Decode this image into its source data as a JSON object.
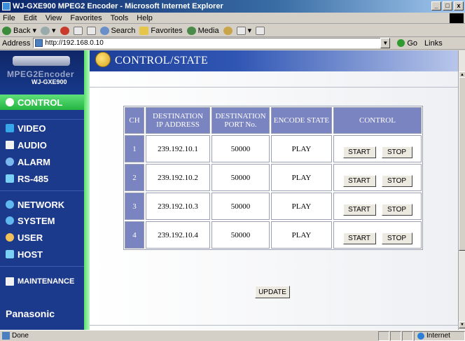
{
  "window": {
    "title": "WJ-GXE900 MPEG2 Encoder - Microsoft Internet Explorer",
    "min": "_",
    "max": "□",
    "close": "x"
  },
  "menu": [
    "File",
    "Edit",
    "View",
    "Favorites",
    "Tools",
    "Help"
  ],
  "toolbar": {
    "back": "Back",
    "search": "Search",
    "favorites": "Favorites",
    "media": "Media"
  },
  "address": {
    "label": "Address",
    "url": "http://192.168.0.10",
    "go": "Go",
    "links": "Links"
  },
  "sidebar": {
    "model_line1": "MPEG2Encoder",
    "model_line2": "WJ-GXE900",
    "items": {
      "control": "CONTROL",
      "video": "VIDEO",
      "audio": "AUDIO",
      "alarm": "ALARM",
      "rs485": "RS-485",
      "network": "NETWORK",
      "system": "SYSTEM",
      "user": "USER",
      "host": "HOST",
      "maintenance": "MAINTENANCE"
    },
    "brand": "Panasonic"
  },
  "page": {
    "title": "CONTROL/STATE",
    "update": "UPDATE"
  },
  "table": {
    "headers": {
      "ch": "CH",
      "dest_ip": [
        "DESTINATION",
        "IP ADDRESS"
      ],
      "dest_port": [
        "DESTINATION",
        "PORT No."
      ],
      "encode_state": "ENCODE STATE",
      "control": "CONTROL"
    },
    "rows": [
      {
        "ch": "1",
        "ip": "239.192.10.1",
        "port": "50000",
        "state": "PLAY"
      },
      {
        "ch": "2",
        "ip": "239.192.10.2",
        "port": "50000",
        "state": "PLAY"
      },
      {
        "ch": "3",
        "ip": "239.192.10.3",
        "port": "50000",
        "state": "PLAY"
      },
      {
        "ch": "4",
        "ip": "239.192.10.4",
        "port": "50000",
        "state": "PLAY"
      }
    ],
    "start_label": "START",
    "stop_label": "STOP"
  },
  "status": {
    "left": "Done",
    "zone": "Internet"
  }
}
